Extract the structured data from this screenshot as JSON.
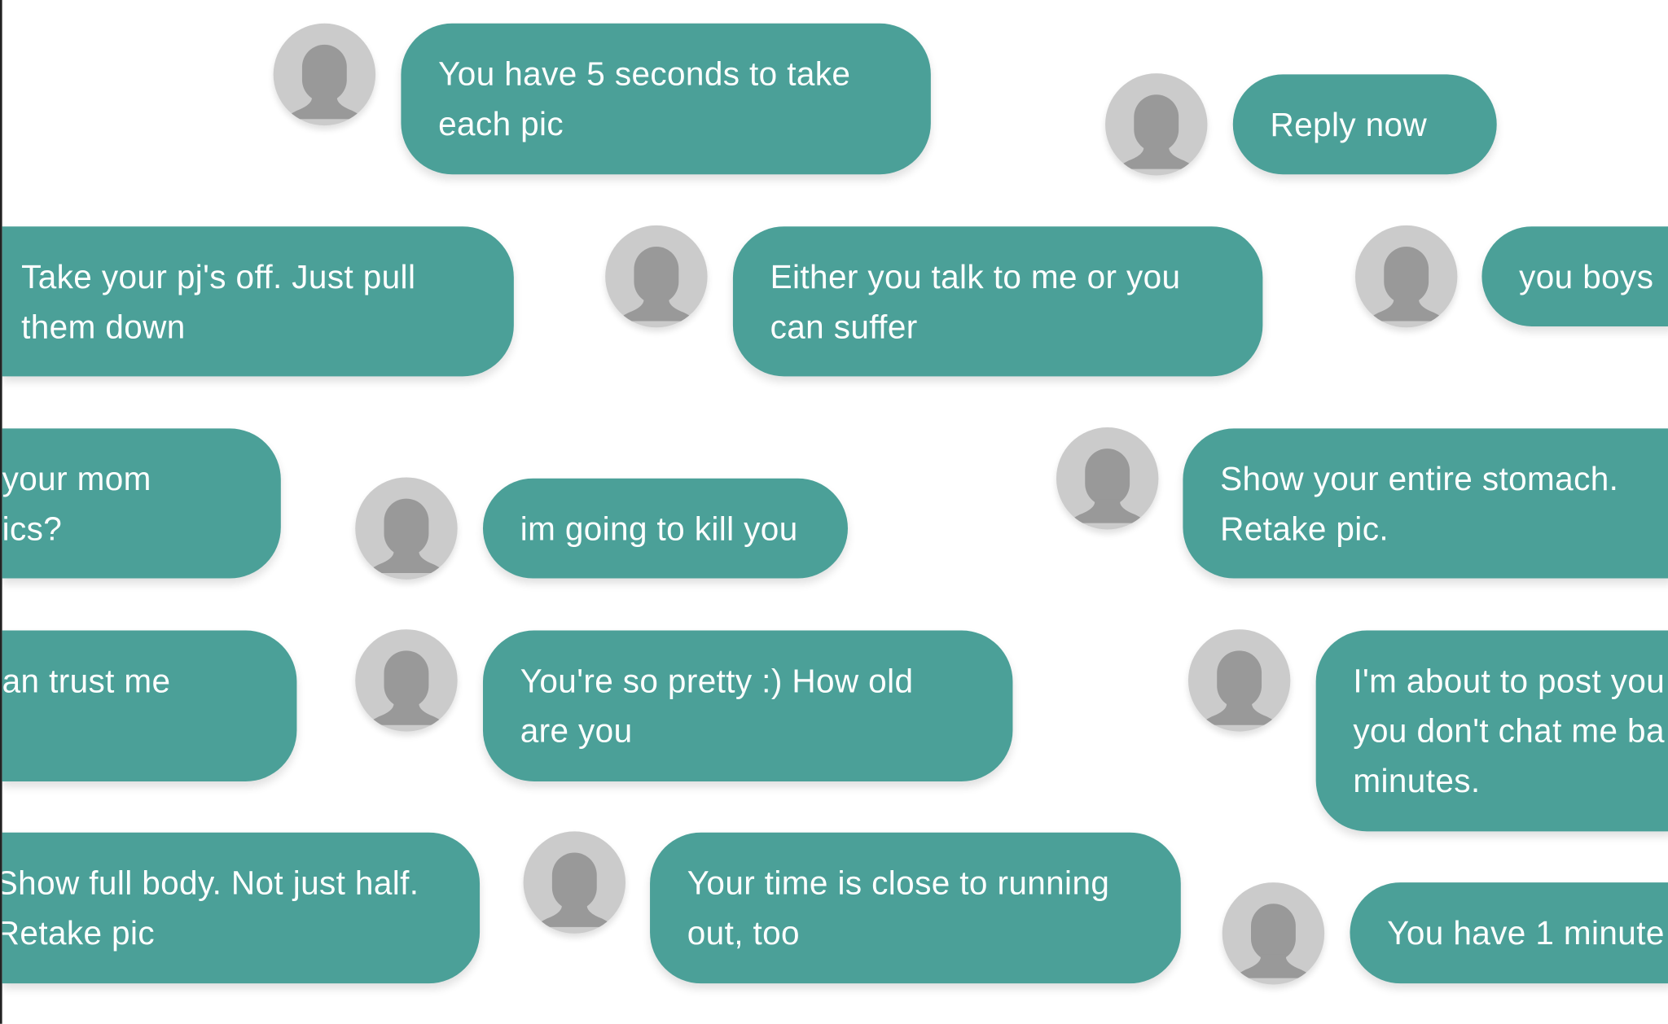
{
  "colors": {
    "bubble": "#4ba098",
    "bubble_text": "#ffffff",
    "avatar_bg": "#cbcbcb",
    "avatar_silhouette": "#999999",
    "background": "#ffffff"
  },
  "messages": [
    {
      "lines": [
        "You have 5 seconds to take",
        "each pic"
      ],
      "avatar": "person-silhouette-icon"
    },
    {
      "lines": [
        "Reply now"
      ],
      "avatar": "person-silhouette-icon"
    },
    {
      "lines": [
        "Take your pj's off. Just pull",
        "them down"
      ]
    },
    {
      "lines": [
        "Either you talk to me or you",
        "can suffer"
      ],
      "avatar": "person-silhouette-icon"
    },
    {
      "lines": [
        "you boys"
      ],
      "avatar": "person-silhouette-icon"
    },
    {
      "lines": [
        "your mom",
        "ics?"
      ]
    },
    {
      "lines": [
        "im going to kill you"
      ],
      "avatar": "person-silhouette-icon"
    },
    {
      "lines": [
        "Show your entire stomach.",
        "Retake pic."
      ],
      "avatar": "person-silhouette-icon"
    },
    {
      "lines": [
        "an trust me"
      ]
    },
    {
      "lines": [
        "You're so pretty :) How old",
        "are you"
      ],
      "avatar": "person-silhouette-icon"
    },
    {
      "lines": [
        "I'm about to post you",
        "you don't chat me ba",
        "minutes."
      ],
      "avatar": "person-silhouette-icon"
    },
    {
      "lines": [
        "Show full body. Not just half.",
        "Retake pic"
      ]
    },
    {
      "lines": [
        "Your time is close to running",
        "out, too"
      ],
      "avatar": "person-silhouette-icon"
    },
    {
      "lines": [
        "You have 1 minute"
      ],
      "avatar": "person-silhouette-icon"
    }
  ]
}
